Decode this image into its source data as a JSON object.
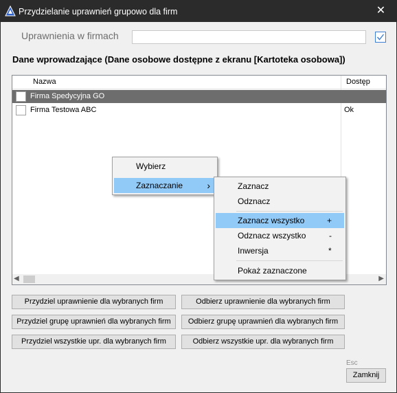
{
  "window": {
    "title": "Przydzielanie uprawnień grupowo dla firm",
    "close_glyph": "✕"
  },
  "filter": {
    "label": "Uprawnienia w firmach",
    "value": "",
    "checked": true
  },
  "section_title": "Dane wprowadzające (Dane osobowe dostępne z ekranu [Kartoteka osobowa])",
  "grid": {
    "columns": {
      "name": "Nazwa",
      "access": "Dostęp"
    },
    "rows": [
      {
        "name": "Firma Spedycyjna GO",
        "access": "",
        "selected": true
      },
      {
        "name": "Firma Testowa ABC",
        "access": "Ok",
        "selected": false
      }
    ],
    "scroll_left": "◀",
    "scroll_right": "▶"
  },
  "buttons": {
    "grant_selected": "Przydziel uprawnienie dla wybranych firm",
    "revoke_selected": "Odbierz uprawnienie dla wybranych firm",
    "grant_group": "Przydziel grupę uprawnień dla wybranych firm",
    "revoke_group": "Odbierz grupę uprawnień dla wybranych firm",
    "grant_all": "Przydziel wszystkie upr. dla wybranych firm",
    "revoke_all": "Odbierz wszystkie upr. dla wybranych firm",
    "close": "Zamknij",
    "close_shortcut": "Esc"
  },
  "context_menu": {
    "items": [
      "Wybierz",
      "Zaznaczanie"
    ],
    "submenu_arrow": "›"
  },
  "submenu": {
    "items": [
      {
        "label": "Zaznacz",
        "shortcut": ""
      },
      {
        "label": "Odznacz",
        "shortcut": ""
      },
      {
        "label": "Zaznacz wszystko",
        "shortcut": "+"
      },
      {
        "label": "Odznacz wszystko",
        "shortcut": "-"
      },
      {
        "label": "Inwersja",
        "shortcut": "*"
      },
      {
        "label": "Pokaż zaznaczone",
        "shortcut": ""
      }
    ]
  },
  "colors": {
    "titlebar": "#2b2b2b",
    "selected_row": "#6d6d6d",
    "menu_highlight": "#91c9f7",
    "checkbox_accent": "#3b7ed6"
  }
}
